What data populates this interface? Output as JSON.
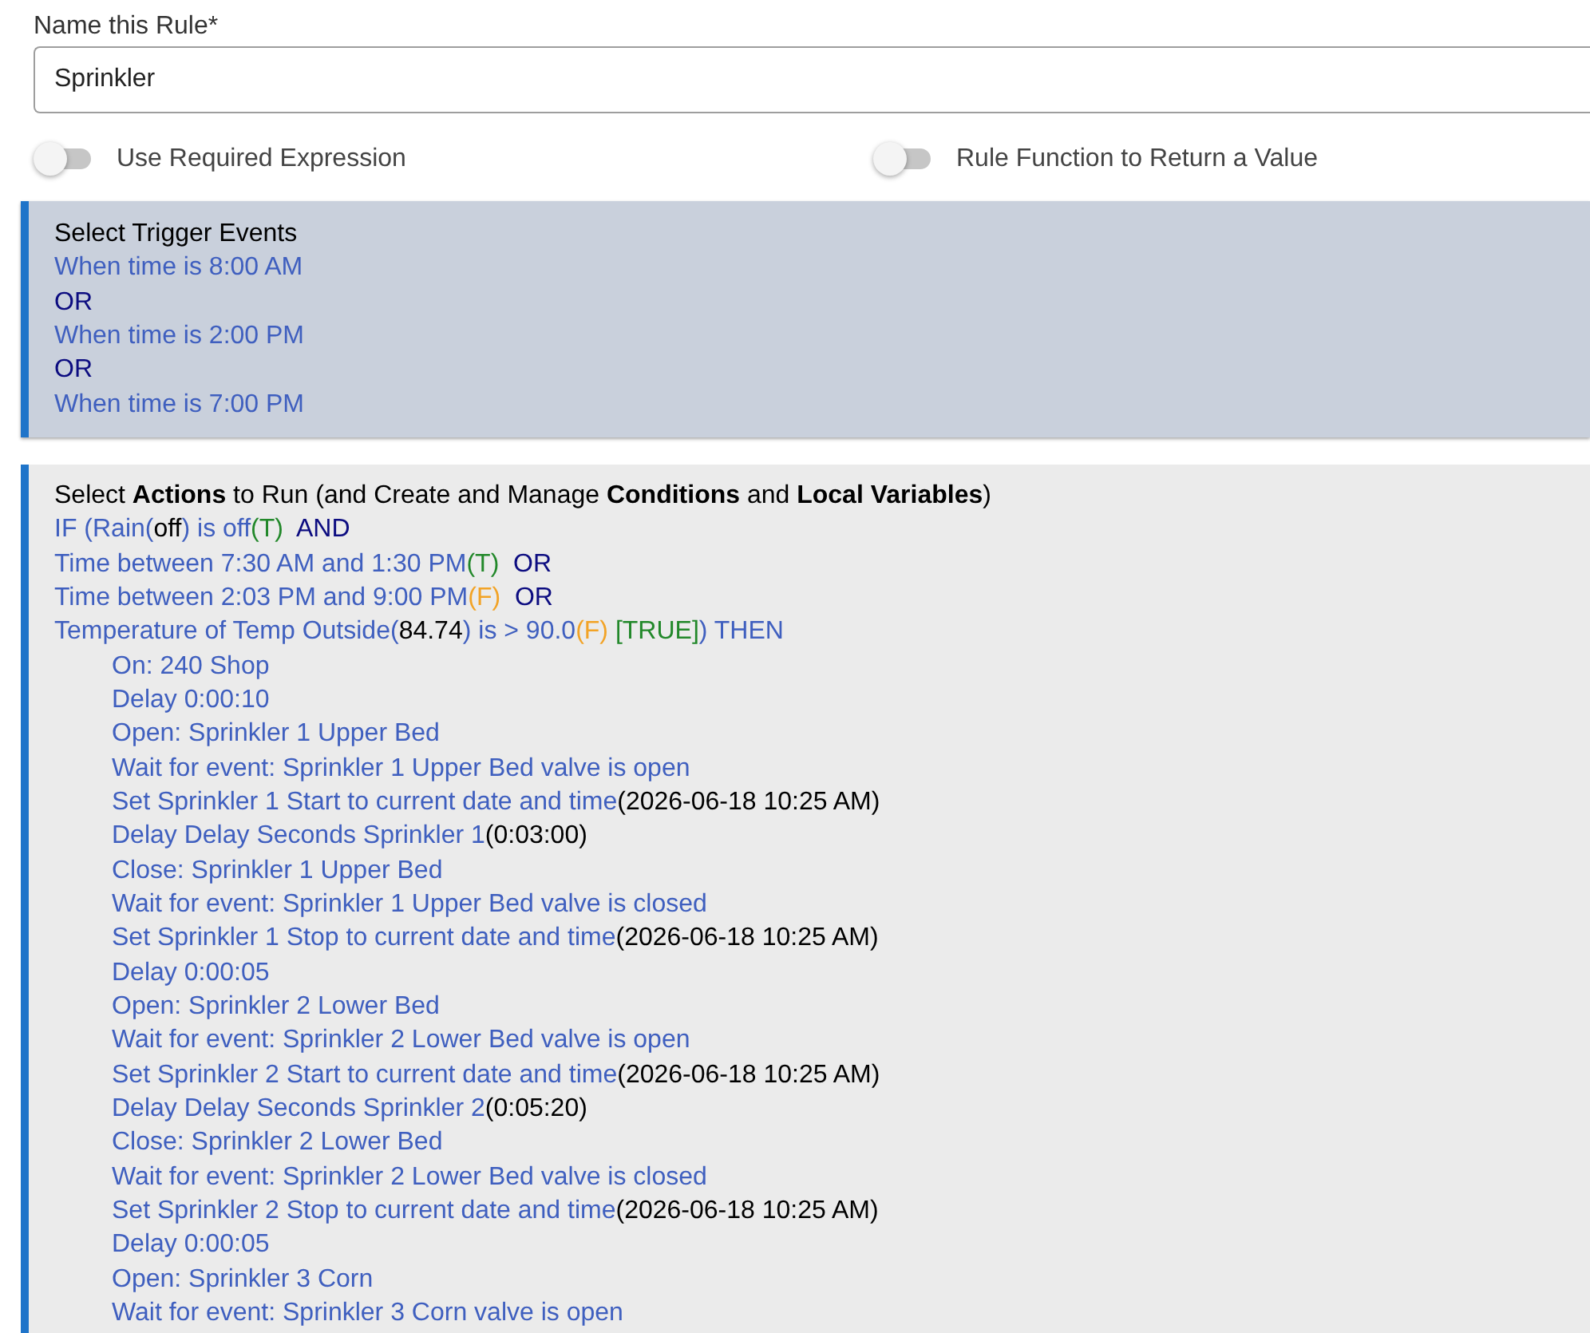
{
  "rule_name": {
    "label": "Name this Rule*",
    "value": "Sprinkler"
  },
  "switches": [
    {
      "label": "Use Required Expression",
      "on": false
    },
    {
      "label": "Rule Function to Return a Value",
      "on": false
    }
  ],
  "trigger_panel": {
    "title": "Select Trigger Events",
    "lines": [
      {
        "segments": [
          {
            "kind": "text",
            "text": "When time is 8:00 AM"
          }
        ]
      },
      {
        "segments": [
          {
            "kind": "operator",
            "text": "OR"
          }
        ]
      },
      {
        "segments": [
          {
            "kind": "text",
            "text": "When time is 2:00 PM"
          }
        ]
      },
      {
        "segments": [
          {
            "kind": "operator",
            "text": "OR"
          }
        ]
      },
      {
        "segments": [
          {
            "kind": "text",
            "text": "When time is 7:00 PM"
          }
        ]
      }
    ]
  },
  "actions_panel": {
    "title": "Select **Actions** to Run (and Create and Manage **Conditions** and **Local Variables**)",
    "lines": [
      {
        "segments": [
          {
            "kind": "text",
            "text": "IF (Rain("
          },
          {
            "kind": "value",
            "text": "off"
          },
          {
            "kind": "text",
            "text": ") is off"
          },
          {
            "kind": "true",
            "text": "(T)"
          },
          {
            "kind": "operator",
            "text": "  AND"
          }
        ]
      },
      {
        "segments": [
          {
            "kind": "text",
            "text": "Time between 7:30 AM and 1:30 PM"
          },
          {
            "kind": "true",
            "text": "(T)"
          },
          {
            "kind": "operator",
            "text": "  OR"
          }
        ]
      },
      {
        "segments": [
          {
            "kind": "text",
            "text": "Time between 2:03 PM and 9:00 PM"
          },
          {
            "kind": "false",
            "text": "(F)"
          },
          {
            "kind": "operator",
            "text": "  OR"
          }
        ]
      },
      {
        "segments": [
          {
            "kind": "text",
            "text": "Temperature of Temp Outside("
          },
          {
            "kind": "value",
            "text": "84.74"
          },
          {
            "kind": "text",
            "text": ") is > 90.0"
          },
          {
            "kind": "false",
            "text": "(F)"
          },
          {
            "kind": "true",
            "text": " [TRUE]"
          },
          {
            "kind": "text",
            "text": ") THEN"
          }
        ],
        "children": [
          {
            "segments": [
              {
                "kind": "text",
                "text": "On: 240 Shop"
              }
            ]
          },
          {
            "segments": [
              {
                "kind": "text",
                "text": "Delay 0:00:10"
              }
            ]
          },
          {
            "segments": [
              {
                "kind": "text",
                "text": "Open: Sprinkler 1 Upper Bed"
              }
            ]
          },
          {
            "segments": [
              {
                "kind": "text",
                "text": "Wait for event: Sprinkler 1 Upper Bed valve is open"
              }
            ]
          },
          {
            "segments": [
              {
                "kind": "text",
                "text": "Set Sprinkler 1 Start to current date and time"
              },
              {
                "kind": "value",
                "text": "(2026-06-18 10:25 AM)"
              }
            ]
          },
          {
            "segments": [
              {
                "kind": "text",
                "text": "Delay Delay Seconds Sprinkler 1"
              },
              {
                "kind": "value",
                "text": "(0:03:00)"
              }
            ]
          },
          {
            "segments": [
              {
                "kind": "text",
                "text": "Close: Sprinkler 1 Upper Bed"
              }
            ]
          },
          {
            "segments": [
              {
                "kind": "text",
                "text": "Wait for event: Sprinkler 1 Upper Bed valve is closed"
              }
            ]
          },
          {
            "segments": [
              {
                "kind": "text",
                "text": "Set Sprinkler 1 Stop to current date and time"
              },
              {
                "kind": "value",
                "text": "(2026-06-18 10:25 AM)"
              }
            ]
          },
          {
            "segments": [
              {
                "kind": "text",
                "text": "Delay 0:00:05"
              }
            ]
          },
          {
            "segments": [
              {
                "kind": "text",
                "text": "Open: Sprinkler 2 Lower Bed"
              }
            ]
          },
          {
            "segments": [
              {
                "kind": "text",
                "text": "Wait for event: Sprinkler 2 Lower Bed valve is open"
              }
            ]
          },
          {
            "segments": [
              {
                "kind": "text",
                "text": "Set Sprinkler 2 Start to current date and time"
              },
              {
                "kind": "value",
                "text": "(2026-06-18 10:25 AM)"
              }
            ]
          },
          {
            "segments": [
              {
                "kind": "text",
                "text": "Delay Delay Seconds Sprinkler 2"
              },
              {
                "kind": "value",
                "text": "(0:05:20)"
              }
            ]
          },
          {
            "segments": [
              {
                "kind": "text",
                "text": "Close: Sprinkler 2 Lower Bed"
              }
            ]
          },
          {
            "segments": [
              {
                "kind": "text",
                "text": "Wait for event: Sprinkler 2 Lower Bed valve is closed"
              }
            ]
          },
          {
            "segments": [
              {
                "kind": "text",
                "text": "Set Sprinkler 2 Stop to current date and time"
              },
              {
                "kind": "value",
                "text": "(2026-06-18 10:25 AM)"
              }
            ]
          },
          {
            "segments": [
              {
                "kind": "text",
                "text": "Delay 0:00:05"
              }
            ]
          },
          {
            "segments": [
              {
                "kind": "text",
                "text": "Open: Sprinkler 3 Corn"
              }
            ]
          },
          {
            "segments": [
              {
                "kind": "text",
                "text": "Wait for event: Sprinkler 3 Corn valve is open"
              }
            ]
          }
        ]
      }
    ]
  }
}
